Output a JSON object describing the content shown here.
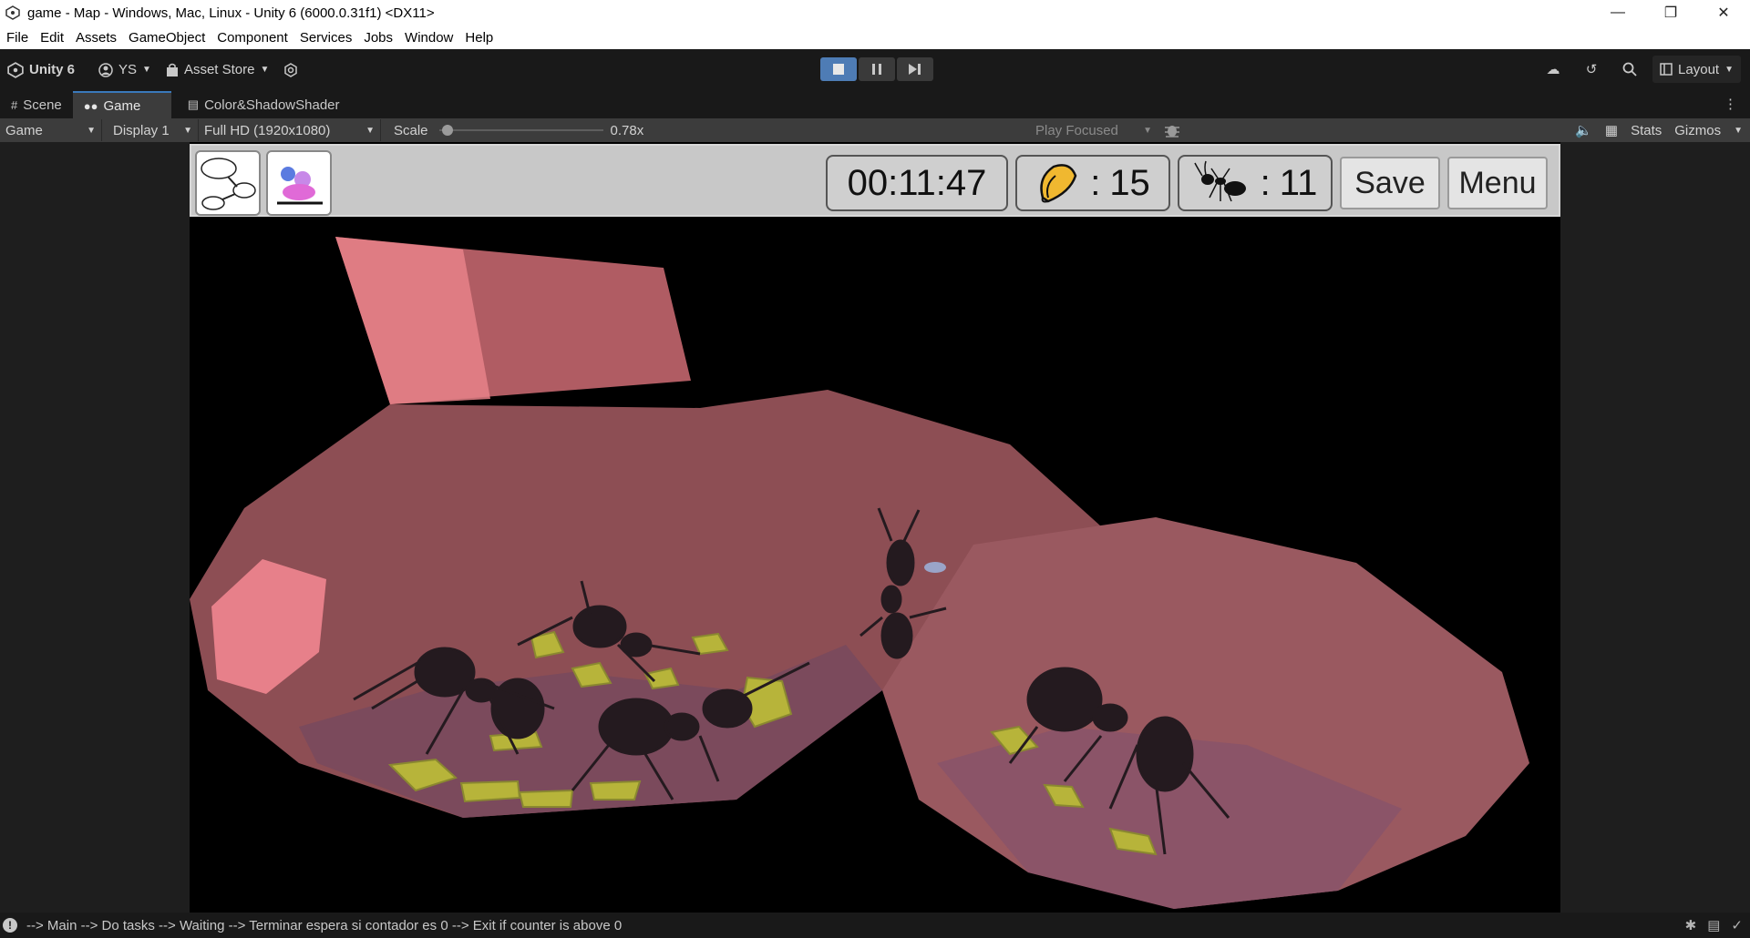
{
  "window": {
    "title": "game - Map - Windows, Mac, Linux - Unity 6 (6000.0.31f1) <DX11>"
  },
  "menu": [
    "File",
    "Edit",
    "Assets",
    "GameObject",
    "Component",
    "Services",
    "Jobs",
    "Window",
    "Help"
  ],
  "toolbar": {
    "unity_label": "Unity 6",
    "account_label": "YS",
    "asset_store_label": "Asset Store",
    "layout_label": "Layout"
  },
  "tabs": [
    {
      "label": "Scene"
    },
    {
      "label": "Game"
    },
    {
      "label": "Color&ShadowShader"
    }
  ],
  "gamebar": {
    "view_dropdown": "Game",
    "display_dropdown": "Display 1",
    "resolution_dropdown": "Full HD (1920x1080)",
    "scale_label": "Scale",
    "scale_value": "0.78x",
    "scale_fraction": 0.02,
    "play_focused": "Play Focused",
    "stats_label": "Stats",
    "gizmos_label": "Gizmos"
  },
  "hud": {
    "timer": "00:11:47",
    "seeds_sep": ":",
    "seeds_count": "15",
    "ants_sep": ":",
    "ants_count": "11",
    "save_label": "Save",
    "menu_label": "Menu"
  },
  "status": {
    "message": "--> Main --> Do tasks --> Waiting --> Terminar espera si contador es 0 --> Exit if counter is above 0"
  },
  "colors": {
    "accent": "#3a79bb",
    "nest_wall": "#8a4c4f",
    "nest_light": "#e7808a",
    "food": "#b7b43a"
  }
}
